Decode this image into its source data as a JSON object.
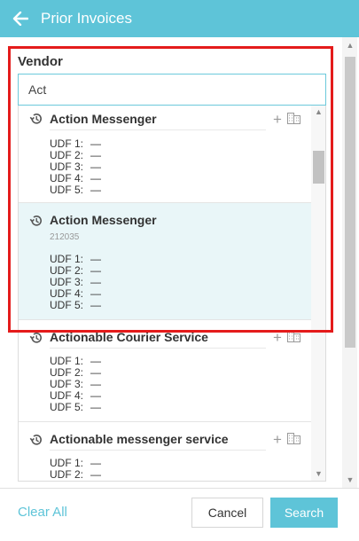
{
  "header": {
    "title": "Prior Invoices"
  },
  "vendor_field": {
    "label": "Vendor",
    "value": "Act"
  },
  "results": [
    {
      "name": "Action Messenger",
      "code": "",
      "udfs": [
        {
          "key": "UDF 1:",
          "value": "—"
        },
        {
          "key": "UDF 2:",
          "value": "—"
        },
        {
          "key": "UDF 3:",
          "value": "—"
        },
        {
          "key": "UDF 4:",
          "value": "—"
        },
        {
          "key": "UDF 5:",
          "value": "—"
        }
      ]
    },
    {
      "name": "Action Messenger",
      "code": "212035",
      "selected": true,
      "udfs": [
        {
          "key": "UDF 1:",
          "value": "—"
        },
        {
          "key": "UDF 2:",
          "value": "—"
        },
        {
          "key": "UDF 3:",
          "value": "—"
        },
        {
          "key": "UDF 4:",
          "value": "—"
        },
        {
          "key": "UDF 5:",
          "value": "—"
        }
      ]
    },
    {
      "name": "Actionable Courier Service",
      "code": "",
      "udfs": [
        {
          "key": "UDF 1:",
          "value": "—"
        },
        {
          "key": "UDF 2:",
          "value": "—"
        },
        {
          "key": "UDF 3:",
          "value": "—"
        },
        {
          "key": "UDF 4:",
          "value": "—"
        },
        {
          "key": "UDF 5:",
          "value": "—"
        }
      ]
    },
    {
      "name": "Actionable messenger service",
      "code": "",
      "udfs": [
        {
          "key": "UDF 1:",
          "value": "—"
        },
        {
          "key": "UDF 2:",
          "value": "—"
        }
      ]
    }
  ],
  "footer": {
    "clear_label": "Clear All",
    "cancel_label": "Cancel",
    "search_label": "Search"
  },
  "colors": {
    "accent": "#5ec4d8",
    "selected_row": "#e9f6f8",
    "annotation_outline": "#e41b1b"
  },
  "icons": {
    "back": "arrow-left-icon",
    "recent": "history-icon",
    "add": "plus-icon",
    "vendor_record": "building-icon"
  }
}
